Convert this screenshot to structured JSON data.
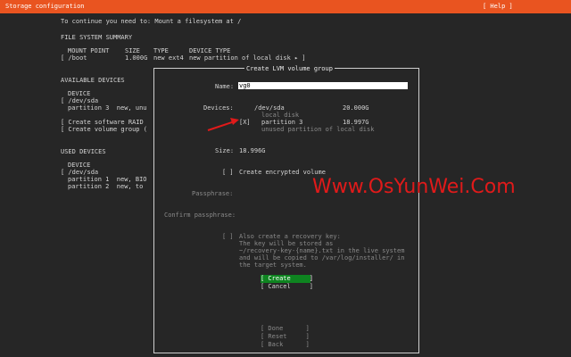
{
  "header": {
    "title": "Storage configuration",
    "help": "[ Help ]"
  },
  "instructions": "To continue you need to: Mount a filesystem at /",
  "summary": {
    "heading": "FILE SYSTEM SUMMARY",
    "columns": [
      "MOUNT POINT",
      "SIZE",
      "TYPE",
      "DEVICE TYPE"
    ],
    "row": {
      "mount": "[ /boot",
      "size": "1.000G",
      "type": "new ext4",
      "device": "new partition of local disk ▸ ]"
    }
  },
  "available": {
    "heading": "AVAILABLE DEVICES",
    "device_col": "DEVICE",
    "disk": "[ /dev/sda",
    "partition": "partition 3  new, unu",
    "raid": "[ Create software RAID",
    "lvm": "[ Create volume group ("
  },
  "used": {
    "heading": "USED DEVICES",
    "device_col": "DEVICE",
    "disk": "[ /dev/sda",
    "p1": "partition 1  new, BIO",
    "p2": "partition 2  new, to"
  },
  "dialog": {
    "title": "Create LVM volume group",
    "name_label": "Name:",
    "name_value": "vg0",
    "devices_label": "Devices:",
    "dev_disk": "/dev/sda",
    "dev_disk_size": "20.000G",
    "dev_disk_desc": "local disk",
    "dev_check": "[X]",
    "dev_part": "partition 3",
    "dev_part_size": "18.997G",
    "dev_part_desc": "unused partition of local disk",
    "size_label": "Size:",
    "size_value": "18.996G",
    "encrypt_check": "[ ]",
    "encrypt_label": "Create encrypted volume",
    "pass_label": "Passphrase:",
    "confirm_label": "Confirm passphrase:",
    "recovery_check": "[ ]",
    "recovery_lines": [
      "Also create a recovery key:",
      "The key will be stored as",
      "~/recovery-key-{name}.txt in the live system",
      "and will be copied to /var/log/installer/ in",
      "the target system."
    ],
    "create_btn": "[ Create     ]",
    "cancel_btn": "[ Cancel     ]"
  },
  "bottom": {
    "done": "[ Done      ]",
    "reset": "[ Reset     ]",
    "back": "[ Back      ]"
  },
  "watermark": "Www.OsYunWei.Com",
  "colors": {
    "accent": "#e95420",
    "button": "#0e8420",
    "watermark": "#e01a1a"
  }
}
